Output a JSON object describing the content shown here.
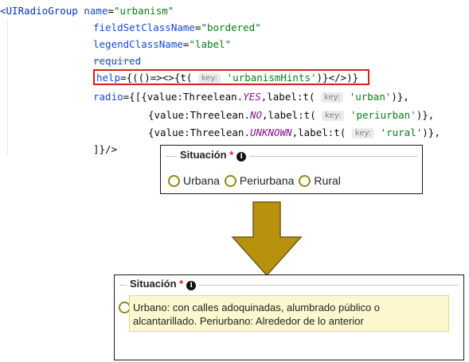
{
  "code": {
    "line1": {
      "open": "<UIRadioGroup",
      "attr": "name",
      "val": "\"urbanism\""
    },
    "line2": {
      "attr": "fieldSetClassName",
      "val": "\"bordered\""
    },
    "line3": {
      "attr": "legendClassName",
      "val": "\"label\""
    },
    "line4": {
      "attr": "required"
    },
    "line5": {
      "attr": "help",
      "pre": "={(()=><>{t(",
      "hint": "key:",
      "str": "'urbanismHints'",
      "post": ")}</>)}"
    },
    "line6": {
      "attr": "radio",
      "pre": "={[{value:Threelean.",
      "enum": "YES",
      "mid": ",label:t(",
      "hint": "key:",
      "str": "'urban'",
      "post": ")},"
    },
    "line7": {
      "pre": "{value:Threelean.",
      "enum": "NO",
      "mid": ",label:t(",
      "hint": "key:",
      "str": "'periurban'",
      "post": ")},"
    },
    "line8": {
      "pre": "{value:Threelean.",
      "enum": "UNKNOWN",
      "mid": ",label:t(",
      "hint": "key:",
      "str": "'rural'",
      "post": ")},"
    },
    "line9": {
      "text": "]}/>"
    }
  },
  "preview": {
    "legend": "Situación",
    "required_mark": "*",
    "info_glyph": "i",
    "options": [
      "Urbana",
      "Periurbana",
      "Rural"
    ]
  },
  "hint_preview": {
    "legend": "Situación",
    "required_mark": "*",
    "info_glyph": "i",
    "tooltip": "Urbano: con calles adoquinadas, alumbrado público o alcantarillado. Periurbano: Alrededor de lo anterior"
  },
  "colors": {
    "highlight_border": "#e01b1b",
    "arrow_fill": "#b8920d",
    "radio_border": "#8a8a1a",
    "tooltip_bg": "#fdf7cf"
  }
}
